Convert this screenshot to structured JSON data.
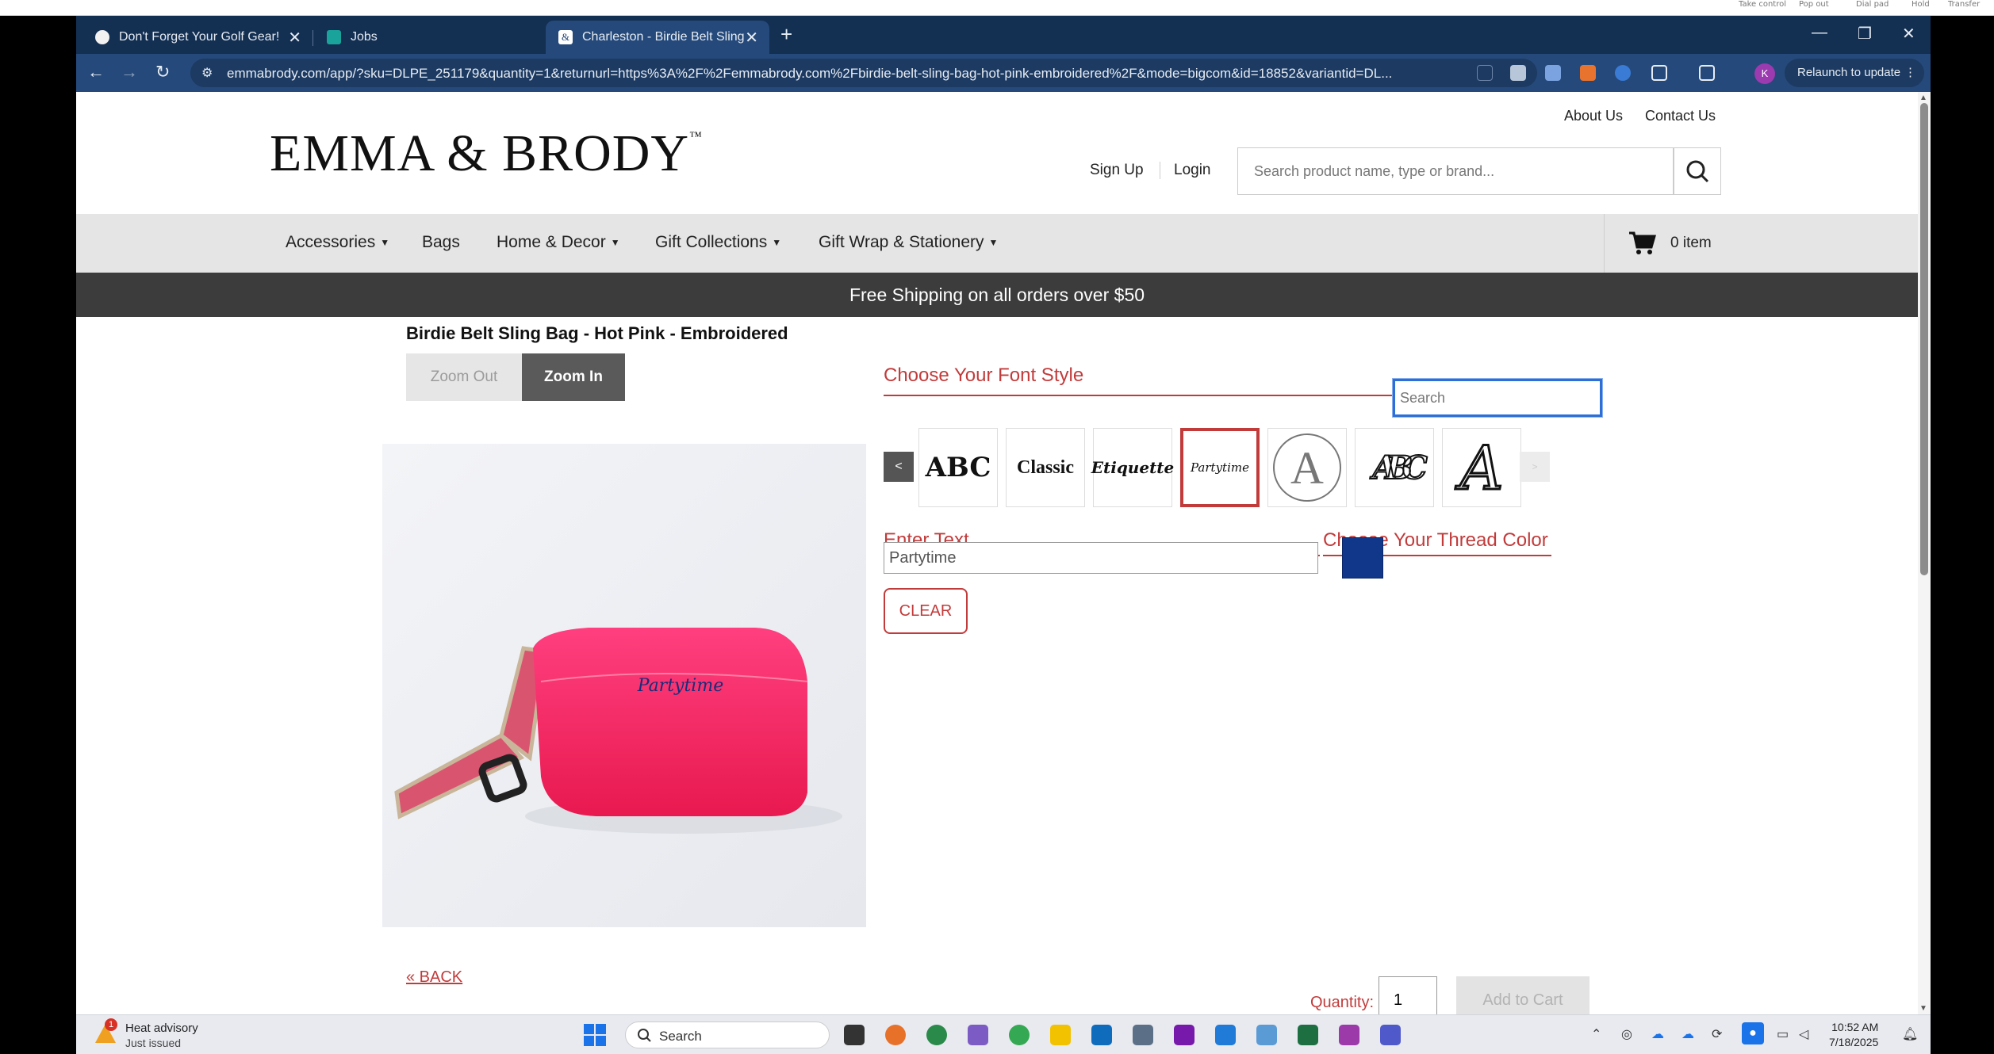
{
  "os_topbar": {
    "controls": [
      "Take control",
      "Pop out",
      "Dial pad",
      "Hold",
      "Transfer"
    ]
  },
  "browser": {
    "tabs": [
      {
        "title": "Don't Forget Your Golf Gear!",
        "active": false
      },
      {
        "title": "Jobs",
        "active": false
      },
      {
        "title": "Charleston - Birdie Belt Sling Ba",
        "active": true
      }
    ],
    "url": "emmabrody.com/app/?sku=DLPE_251179&quantity=1&returnurl=https%3A%2F%2Femmabrody.com%2Fbirdie-belt-sling-bag-hot-pink-embroidered%2F&mode=bigcom&id=18852&variantid=DL...",
    "profile_initial": "K",
    "relaunch_label": "Relaunch to update"
  },
  "site": {
    "logo": "EMMA & BRODY",
    "logo_tm": "™",
    "top_links": {
      "about": "About Us",
      "contact": "Contact Us"
    },
    "signup": "Sign Up",
    "login": "Login",
    "search_placeholder": "Search product name, type or brand...",
    "nav": [
      {
        "label": "Accessories",
        "dropdown": true
      },
      {
        "label": "Bags",
        "dropdown": false
      },
      {
        "label": "Home & Decor",
        "dropdown": true
      },
      {
        "label": "Gift Collections",
        "dropdown": true
      },
      {
        "label": "Gift Wrap & Stationery",
        "dropdown": true
      }
    ],
    "cart_count": "0 item",
    "shipping_banner": "Free Shipping on all orders over $50"
  },
  "product": {
    "title": "Birdie Belt Sling Bag - Hot Pink - Embroidered",
    "zoom_out": "Zoom Out",
    "zoom_in": "Zoom In",
    "embroidery_preview": "Partytime"
  },
  "customizer": {
    "font_style_heading": "Choose Your Font Style",
    "font_search_placeholder": "Search",
    "prev": "<",
    "next": ">",
    "fonts": [
      {
        "sample": "ABC",
        "name": "block"
      },
      {
        "sample": "Classic",
        "name": "classic"
      },
      {
        "sample": "Etiquette",
        "name": "etiquette"
      },
      {
        "sample": "Partytime",
        "name": "partytime",
        "selected": true
      },
      {
        "sample": "A",
        "name": "circle"
      },
      {
        "sample": "ABC",
        "name": "monogram"
      },
      {
        "sample": "A",
        "name": "vine"
      }
    ],
    "enter_text_heading": "Enter Text",
    "text_value": "Partytime",
    "thread_color_heading": "Choose Your Thread Color",
    "thread_color": "#10378a",
    "clear_label": "CLEAR"
  },
  "footer_actions": {
    "back": "« BACK",
    "quantity_label": "Quantity:",
    "quantity_value": "1",
    "add_to_cart": "Add to Cart"
  },
  "taskbar": {
    "weather_title": "Heat advisory",
    "weather_sub": "Just issued",
    "weather_badge": "1",
    "search_label": "Search",
    "time": "10:52 AM",
    "date": "7/18/2025"
  }
}
